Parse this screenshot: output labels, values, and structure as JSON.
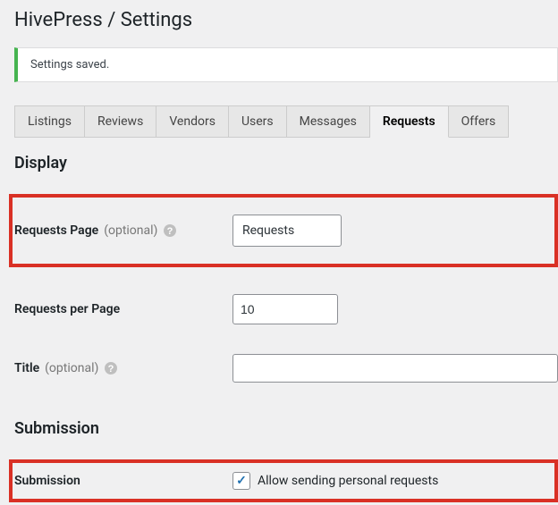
{
  "header": {
    "plugin": "HivePress",
    "separator": " / ",
    "page": "Settings"
  },
  "notice": {
    "message": "Settings saved."
  },
  "tabs": [
    {
      "label": "Listings",
      "active": false
    },
    {
      "label": "Reviews",
      "active": false
    },
    {
      "label": "Vendors",
      "active": false
    },
    {
      "label": "Users",
      "active": false
    },
    {
      "label": "Messages",
      "active": false
    },
    {
      "label": "Requests",
      "active": true
    },
    {
      "label": "Offers",
      "active": false
    }
  ],
  "sections": {
    "display": {
      "title": "Display",
      "requests_page": {
        "label": "Requests Page",
        "optional": "(optional)",
        "value": "Requests"
      },
      "per_page": {
        "label": "Requests per Page",
        "value": "10"
      },
      "title_field": {
        "label": "Title",
        "optional": "(optional)",
        "value": ""
      }
    },
    "submission": {
      "title": "Submission",
      "submission_field": {
        "label": "Submission",
        "checkbox_label": "Allow sending personal requests",
        "checked": true
      }
    }
  }
}
